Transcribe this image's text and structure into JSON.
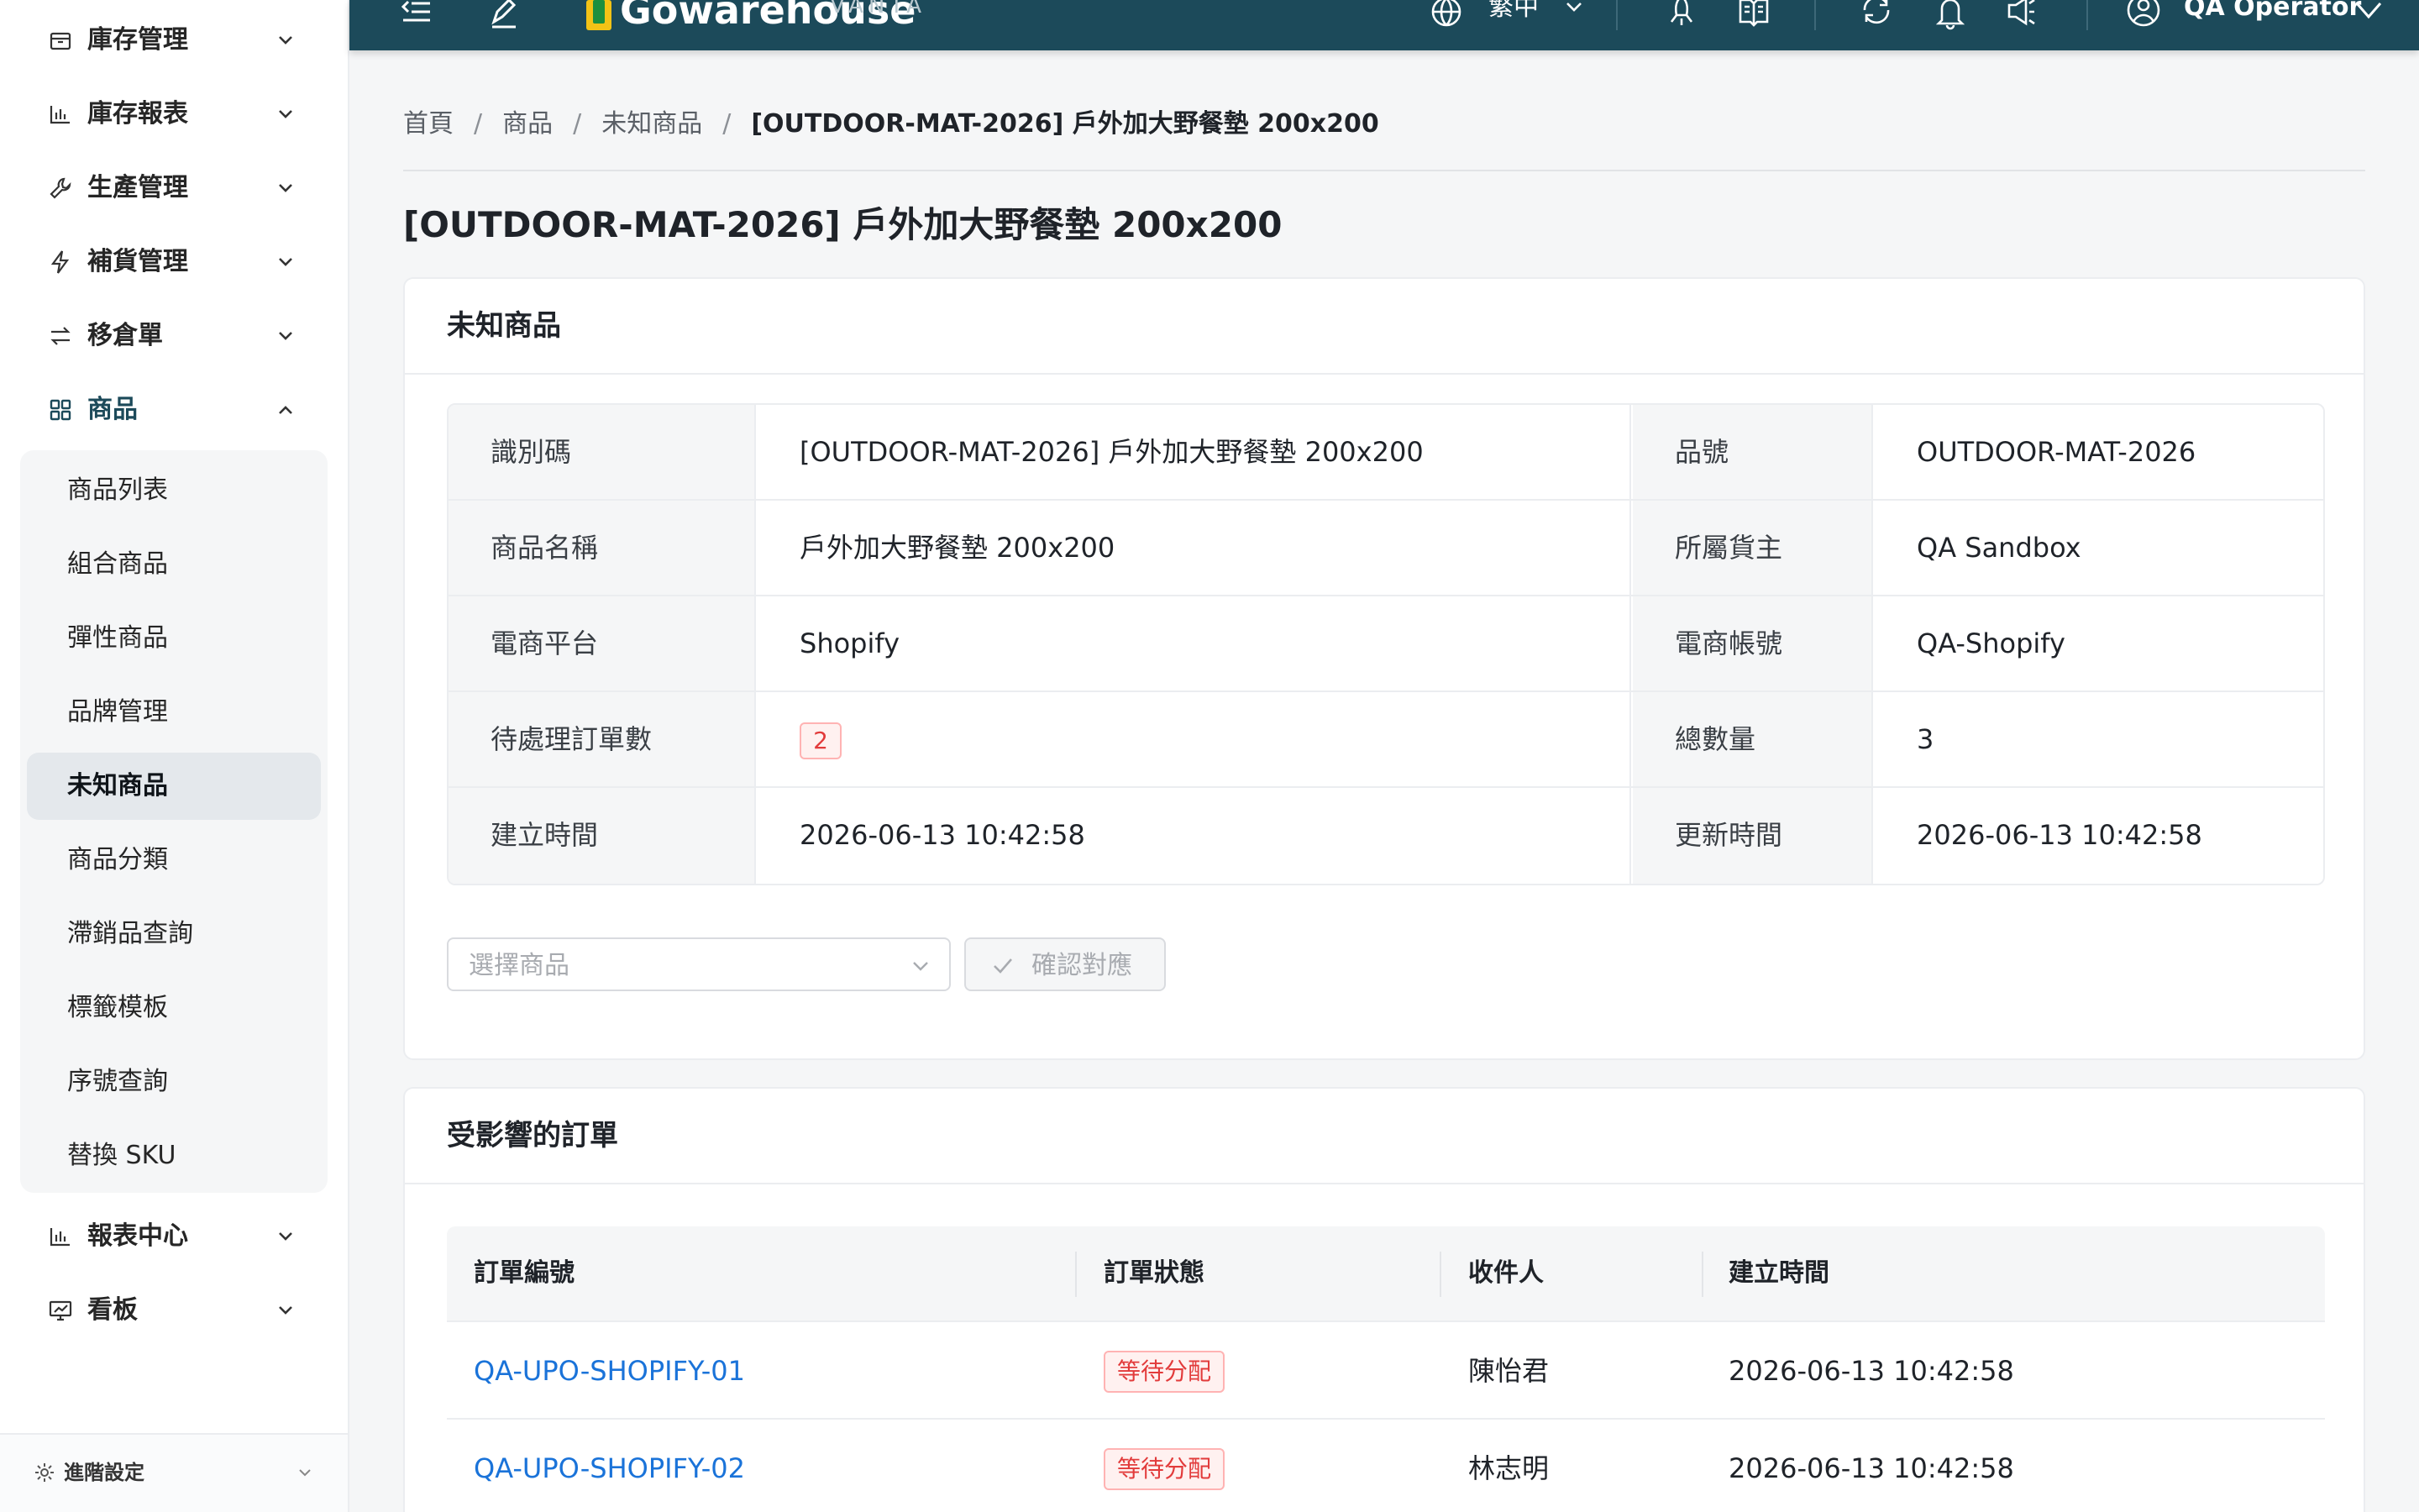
{
  "sidebar": {
    "items": [
      {
        "label": "庫存管理",
        "icon": "inventory-box-icon",
        "expanded": false
      },
      {
        "label": "庫存報表",
        "icon": "bar-chart-icon",
        "expanded": false
      },
      {
        "label": "生產管理",
        "icon": "wrench-icon",
        "expanded": false
      },
      {
        "label": "補貨管理",
        "icon": "lightning-icon",
        "expanded": false
      },
      {
        "label": "移倉單",
        "icon": "transfer-arrows-icon",
        "expanded": false
      },
      {
        "label": "商品",
        "icon": "grid-icon",
        "expanded": true
      },
      {
        "label": "報表中心",
        "icon": "bar-chart-icon",
        "expanded": false
      },
      {
        "label": "看板",
        "icon": "dashboard-icon",
        "expanded": false
      }
    ],
    "submenu": [
      {
        "label": "商品列表"
      },
      {
        "label": "組合商品"
      },
      {
        "label": "彈性商品"
      },
      {
        "label": "品牌管理"
      },
      {
        "label": "未知商品",
        "active": true
      },
      {
        "label": "商品分類"
      },
      {
        "label": "滯銷品查詢"
      },
      {
        "label": "標籤模板"
      },
      {
        "label": "序號查詢"
      },
      {
        "label": "替換 SKU"
      }
    ],
    "footer": {
      "label": "進階設定"
    }
  },
  "topbar": {
    "brand": "Gowarehouse",
    "brand_sub": "VANTA",
    "language": "繁中",
    "user": "QA Operator",
    "bg_color": "#1c4a5a"
  },
  "breadcrumb": {
    "items": [
      "首頁",
      "商品",
      "未知商品"
    ],
    "current": "[OUTDOOR-MAT-2026] 戶外加大野餐墊 200x200"
  },
  "page_title": "[OUTDOOR-MAT-2026] 戶外加大野餐墊 200x200",
  "detail_card": {
    "title": "未知商品",
    "rows": [
      {
        "l1": "識別碼",
        "v1": "[OUTDOOR-MAT-2026] 戶外加大野餐墊 200x200",
        "l2": "品號",
        "v2": "OUTDOOR-MAT-2026"
      },
      {
        "l1": "商品名稱",
        "v1": "戶外加大野餐墊 200x200",
        "l2": "所屬貨主",
        "v2": "QA Sandbox"
      },
      {
        "l1": "電商平台",
        "v1": "Shopify",
        "l2": "電商帳號",
        "v2": "QA-Shopify"
      },
      {
        "l1": "待處理訂單數",
        "v1": "2",
        "l2": "總數量",
        "v2": "3"
      },
      {
        "l1": "建立時間",
        "v1": "2026-06-13 10:42:58",
        "l2": "更新時間",
        "v2": "2026-06-13 10:42:58"
      }
    ],
    "select_placeholder": "選擇商品",
    "confirm_label": "確認對應"
  },
  "orders_card": {
    "title": "受影響的訂單",
    "columns": [
      "訂單編號",
      "訂單狀態",
      "收件人",
      "建立時間"
    ],
    "rows": [
      {
        "order_no": "QA-UPO-SHOPIFY-01",
        "status": "等待分配",
        "recipient": "陳怡君",
        "created": "2026-06-13 10:42:58"
      },
      {
        "order_no": "QA-UPO-SHOPIFY-02",
        "status": "等待分配",
        "recipient": "林志明",
        "created": "2026-06-13 10:42:58"
      }
    ]
  },
  "colors": {
    "link": "#1a73d9",
    "danger": "#e23b3b",
    "active_bg": "#e4e8ec"
  }
}
